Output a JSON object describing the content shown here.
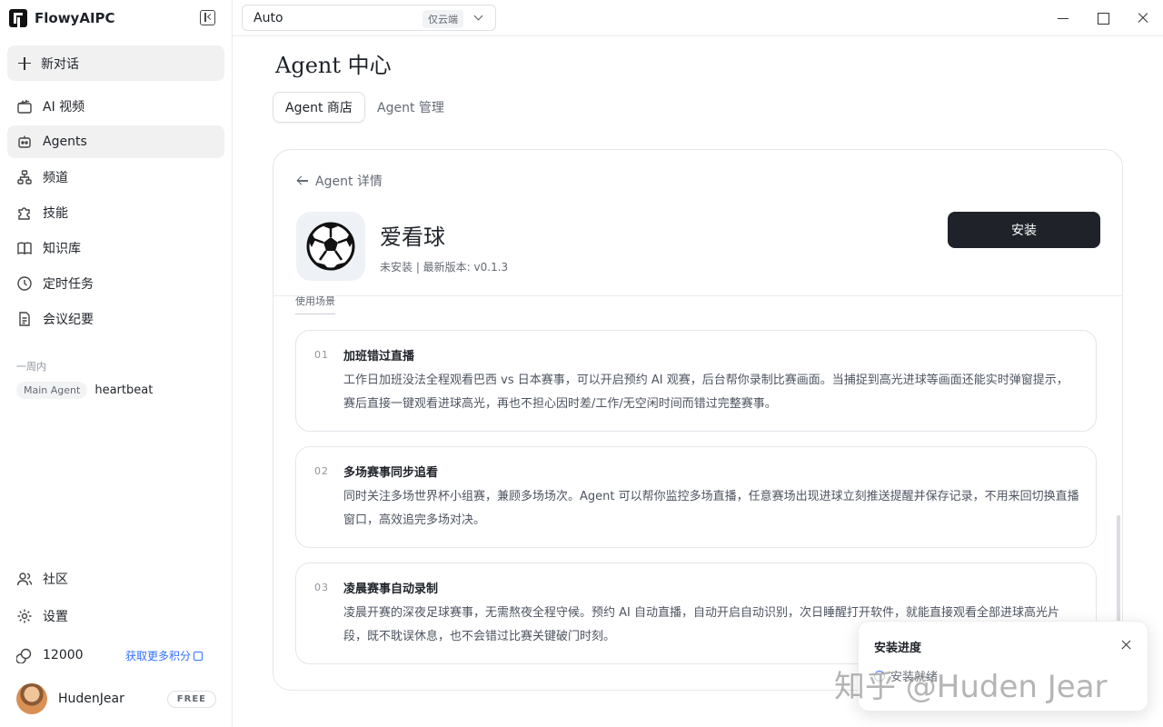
{
  "app": {
    "name": "FlowyAIPC"
  },
  "sidebar": {
    "new_chat": "新对话",
    "items": [
      {
        "label": "AI 视频",
        "icon": "video-icon"
      },
      {
        "label": "Agents",
        "icon": "robot-icon"
      },
      {
        "label": "频道",
        "icon": "channel-icon"
      },
      {
        "label": "技能",
        "icon": "puzzle-icon"
      },
      {
        "label": "知识库",
        "icon": "book-icon"
      },
      {
        "label": "定时任务",
        "icon": "clock-icon"
      },
      {
        "label": "会议纪要",
        "icon": "document-icon"
      }
    ],
    "history_section": "一周内",
    "history": [
      {
        "tag": "Main Agent",
        "title": "heartbeat"
      }
    ],
    "community": "社区",
    "settings": "设置",
    "points": "12000",
    "points_link": "获取更多积分",
    "user": {
      "name": "HudenJear",
      "plan": "FREE"
    }
  },
  "topbar": {
    "model": "Auto",
    "model_tag": "仅云端"
  },
  "main": {
    "title": "Agent 中心",
    "tabs": [
      {
        "label": "Agent 商店",
        "active": true
      },
      {
        "label": "Agent 管理",
        "active": false
      }
    ],
    "detail": {
      "back_label": "Agent 详情",
      "name": "爱看球",
      "meta": "未安装 | 最新版本: v0.1.3",
      "install_label": "安装",
      "section_label": "使用场景",
      "scenes": [
        {
          "num": "01",
          "title": "加班错过直播",
          "desc": "工作日加班没法全程观看巴西 vs 日本赛事，可以开启预约 AI 观赛，后台帮你录制比赛画面。当捕捉到高光进球等画面还能实时弹窗提示，赛后直接一键观看进球高光，再也不担心因时差/工作/无空闲时间而错过完整赛事。"
        },
        {
          "num": "02",
          "title": "多场赛事同步追看",
          "desc": "同时关注多场世界杯小组赛，兼顾多场场次。Agent 可以帮你监控多场直播，任意赛场出现进球立刻推送提醒并保存记录，不用来回切换直播窗口，高效追完多场对决。"
        },
        {
          "num": "03",
          "title": "凌晨赛事自动录制",
          "desc": "凌晨开赛的深夜足球赛事，无需熬夜全程守候。预约 AI 自动直播，自动开启自动识别，次日睡醒打开软件，就能直接观看全部进球高光片段，既不耽误休息，也不会错过比赛关键破门时刻。"
        }
      ]
    }
  },
  "toast": {
    "title": "安装进度",
    "status": "安装就绪"
  },
  "watermark": "知乎 @Huden Jear"
}
